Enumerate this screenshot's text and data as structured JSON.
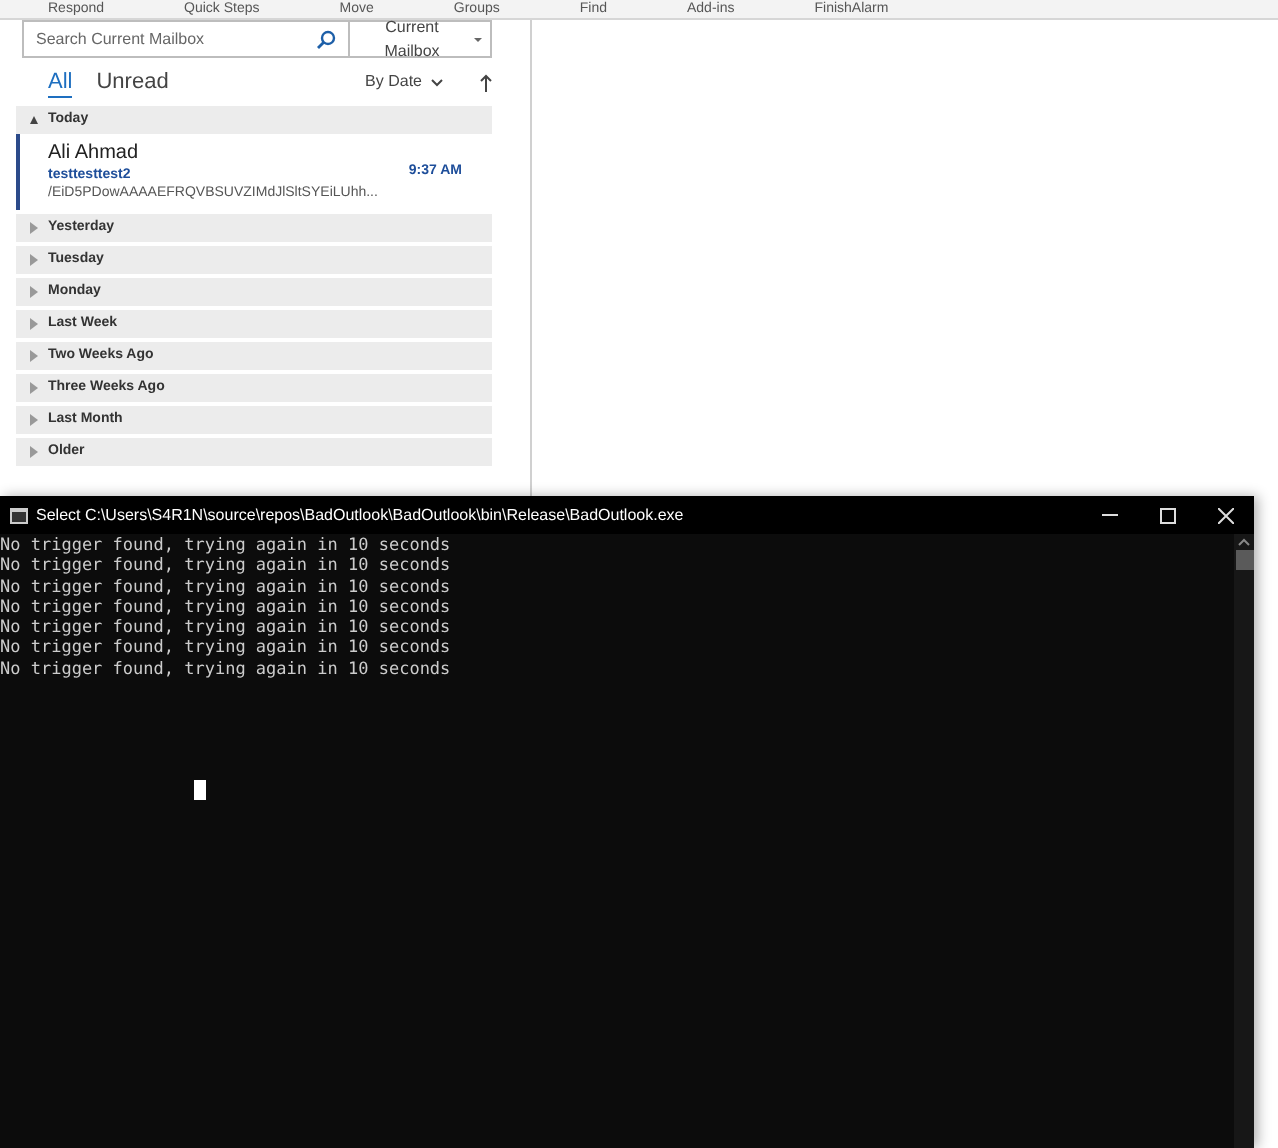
{
  "ribbon_groups": [
    "Respond",
    "Quick Steps",
    "Move",
    "Groups",
    "Find",
    "Add-ins",
    "FinishAlarm"
  ],
  "search": {
    "placeholder": "Search Current Mailbox",
    "scope": "Current Mailbox"
  },
  "filters": [
    {
      "label": "All",
      "selected": true
    },
    {
      "label": "Unread",
      "selected": false
    }
  ],
  "sort": {
    "label": "By Date"
  },
  "groups": [
    {
      "label": "Today",
      "expanded": true,
      "messages": [
        {
          "sender": "Ali Ahmad",
          "subject": "testtesttest2",
          "preview": "/EiD5PDowAAAAEFRQVBSUVZIMdJlSltSYEiLUhh...",
          "time": "9:37 AM",
          "selected": true
        }
      ]
    },
    {
      "label": "Yesterday",
      "expanded": false
    },
    {
      "label": "Tuesday",
      "expanded": false
    },
    {
      "label": "Monday",
      "expanded": false
    },
    {
      "label": "Last Week",
      "expanded": false
    },
    {
      "label": "Two Weeks Ago",
      "expanded": false
    },
    {
      "label": "Three Weeks Ago",
      "expanded": false
    },
    {
      "label": "Last Month",
      "expanded": false
    },
    {
      "label": "Older",
      "expanded": false
    }
  ],
  "console": {
    "title": "Select C:\\Users\\S4R1N\\source\\repos\\BadOutlook\\BadOutlook\\bin\\Release\\BadOutlook.exe",
    "lines": [
      "No trigger found, trying again in 10 seconds",
      "No trigger found, trying again in 10 seconds",
      "No trigger found, trying again in 10 seconds",
      "No trigger found, trying again in 10 seconds",
      "No trigger found, trying again in 10 seconds",
      "No trigger found, trying again in 10 seconds",
      "No trigger found, trying again in 10 seconds"
    ]
  }
}
